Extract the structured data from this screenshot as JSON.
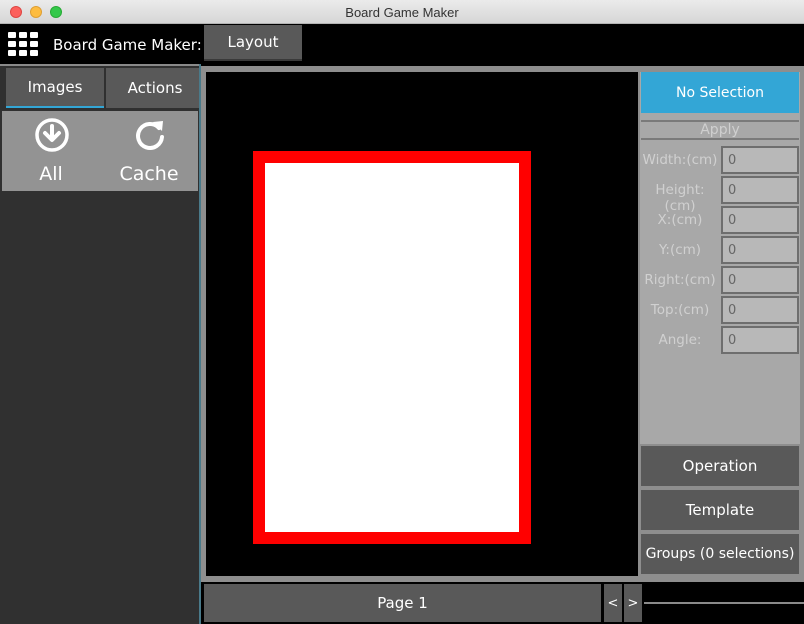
{
  "window": {
    "title": "Board Game Maker"
  },
  "topbar": {
    "app_label": "Board Game Maker:",
    "layout_button": "Layout",
    "menu_icon": "grid-menu-icon"
  },
  "left_panel": {
    "tabs": [
      {
        "label": "Images"
      },
      {
        "label": "Actions"
      }
    ],
    "tools": [
      {
        "label": "All",
        "icon": "download-circle-icon"
      },
      {
        "label": "Cache",
        "icon": "refresh-icon"
      }
    ]
  },
  "right_panel": {
    "selection_label": "No Selection",
    "apply_label": "Apply",
    "fields": [
      {
        "label": "Width:(cm)",
        "value": "0"
      },
      {
        "label": "Height:(cm)",
        "value": "0"
      },
      {
        "label": "X:(cm)",
        "value": "0"
      },
      {
        "label": "Y:(cm)",
        "value": "0"
      },
      {
        "label": "Right:(cm)",
        "value": "0"
      },
      {
        "label": "Top:(cm)",
        "value": "0"
      },
      {
        "label": "Angle:",
        "value": "0"
      }
    ],
    "buttons": {
      "operation": "Operation",
      "template": "Template",
      "groups": "Groups (0 selections)"
    }
  },
  "bottom_bar": {
    "page_label": "Page 1",
    "prev": "<",
    "next": ">"
  },
  "colors": {
    "accent": "#33a6d6",
    "card_border": "#ff0000",
    "card_fill": "#ffffff"
  }
}
